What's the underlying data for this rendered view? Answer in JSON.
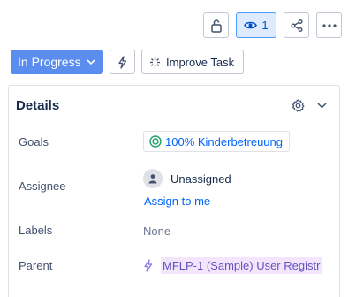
{
  "toolbar": {
    "lock_icon": "unlock-icon",
    "watch_count": "1",
    "share_icon": "share-icon",
    "more_icon": "more-icon"
  },
  "actions": {
    "status_label": "In Progress",
    "status_color": "#5b8def",
    "improve_label": "Improve Task"
  },
  "details": {
    "title": "Details",
    "fields": {
      "goals_label": "Goals",
      "goals_value": "100% Kinderbetreuung",
      "assignee_label": "Assignee",
      "assignee_value": "Unassigned",
      "assign_to_me": "Assign to me",
      "labels_label": "Labels",
      "labels_value": "None",
      "parent_label": "Parent",
      "parent_value": "MFLP-1 (Sample) User Registr"
    }
  }
}
